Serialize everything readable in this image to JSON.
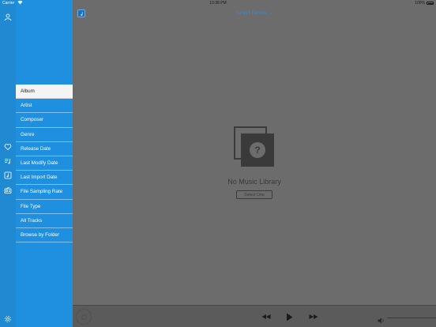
{
  "status_bar": {
    "carrier": "Carrier",
    "time": "10:38 PM",
    "battery": "100%"
  },
  "rail": {
    "icons": [
      "user-icon",
      "heart-icon",
      "playlist-icon",
      "music-library-icon",
      "radio-icon",
      "gear-icon"
    ]
  },
  "panel": {
    "items": [
      {
        "label": "Album",
        "active": true
      },
      {
        "label": "Artist"
      },
      {
        "label": "Composer"
      },
      {
        "label": "Genre"
      },
      {
        "label": "Release Date"
      },
      {
        "label": "Last Modify Date"
      },
      {
        "label": "Last Import Date"
      },
      {
        "label": "File Sampling Rate"
      },
      {
        "label": "File Type"
      },
      {
        "label": "All Tracks"
      },
      {
        "label": "Browse by Folder"
      }
    ]
  },
  "topbar": {
    "title": "Select Device",
    "title_chevron": "⌄"
  },
  "empty_state": {
    "title": "No Music Library",
    "button": "Select One",
    "icon_glyph": "?"
  },
  "player": {
    "controls": [
      "rewind-icon",
      "play-icon",
      "fast-forward-icon",
      "volume-icon"
    ]
  },
  "colors": {
    "accent": "#1f8fe0",
    "title_blue": "#2a8ee8"
  }
}
